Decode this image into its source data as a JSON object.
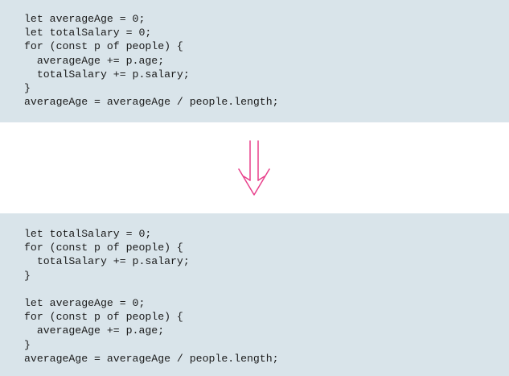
{
  "before": {
    "lines": [
      "let averageAge = 0;",
      "let totalSalary = 0;",
      "for (const p of people) {",
      "  averageAge += p.age;",
      "  totalSalary += p.salary;",
      "}",
      "averageAge = averageAge / people.length;"
    ]
  },
  "after": {
    "lines": [
      "let totalSalary = 0;",
      "for (const p of people) {",
      "  totalSalary += p.salary;",
      "}",
      "",
      "let averageAge = 0;",
      "for (const p of people) {",
      "  averageAge += p.age;",
      "}",
      "averageAge = averageAge / people.length;"
    ]
  },
  "arrow": {
    "icon": "double-down-arrow-icon",
    "color": "#e8418c"
  },
  "colors": {
    "panel_background": "#d9e4ea",
    "code_text": "#1a1a1a"
  }
}
